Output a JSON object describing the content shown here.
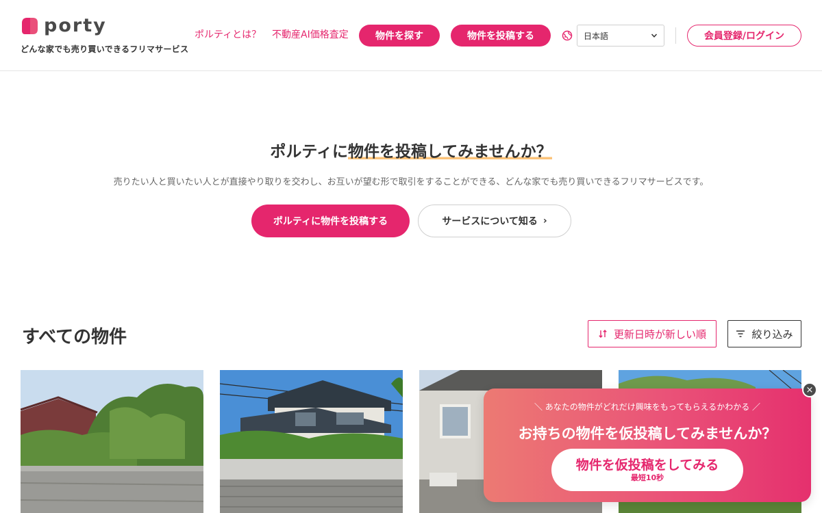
{
  "header": {
    "logo_text": "porty",
    "tagline": "どんな家でも売り買いできるフリマサービス",
    "nav": {
      "about": "ポルティとは？",
      "ai_valuation": "不動産AI価格査定",
      "search": "物件を探す",
      "post": "物件を投稿する"
    },
    "language": {
      "selected": "日本語"
    },
    "login_label": "会員登録/ログイン"
  },
  "hero": {
    "title_before": "ポルティに",
    "title_highlight": "物件を投稿",
    "title_after": "してみませんか？",
    "description": "売りたい人と買いたい人とが直接やり取りを交わし、お互いが望む形で取引をすることができる、どんな家でも売り買いできるフリマサービスです。",
    "primary_cta": "ポルティに物件を投稿する",
    "secondary_cta": "サービスについて知る",
    "secondary_cta_chevron": "›"
  },
  "listing": {
    "title": "すべての物件",
    "sort_label": "更新日時が新しい順",
    "filter_label": "絞り込み"
  },
  "promo": {
    "subtitle": "あなたの物件がどれだけ興味をもってもらえるかわかる",
    "title": "お持ちの物件を仮投稿してみませんか？",
    "button_main": "物件を仮投稿をしてみる",
    "button_sub": "最短10秒",
    "close_symbol": "×"
  },
  "colors": {
    "accent": "#e5266d",
    "highlight": "#fbc37a",
    "text": "#333333",
    "promo_gradient_start": "#ec7a73",
    "promo_gradient_end": "#e5306e"
  },
  "icons": {
    "logo": "porty-logo-icon",
    "globe": "globe-icon",
    "select": "chevron-down-icon",
    "sort": "sort-arrows-icon",
    "filter": "filter-lines-icon",
    "close": "close-icon"
  }
}
